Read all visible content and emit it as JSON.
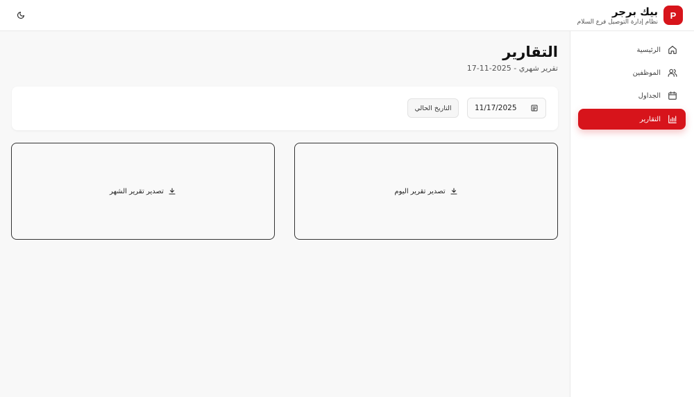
{
  "header": {
    "brand_initial": "P",
    "brand_name": "بيك برجر",
    "brand_subtitle": "نظام إدارة التوصيل فرع السلام",
    "theme_toggle_icon": "moon-icon"
  },
  "sidebar": {
    "items": [
      {
        "label": "الرئيسية",
        "icon": "home-icon",
        "active": false
      },
      {
        "label": "الموظفين",
        "icon": "users-icon",
        "active": false
      },
      {
        "label": "الجداول",
        "icon": "calendar-icon",
        "active": false
      },
      {
        "label": "التقارير",
        "icon": "bar-chart-icon",
        "active": true
      }
    ]
  },
  "main": {
    "title": "التقارير",
    "subtitle": "تقرير شهري - 2025-11-17",
    "filter": {
      "date_value": "11/17/2025",
      "date_icon": "calendar-picker-icon",
      "today_button": "التاريخ الحالي"
    },
    "exports": {
      "today_label": "تصدير تقرير اليوم",
      "month_label": "تصدير تقرير الشهر",
      "icon": "download-icon"
    }
  },
  "colors": {
    "accent": "#d7141b",
    "background": "#f8f8f8",
    "surface": "#ffffff"
  }
}
